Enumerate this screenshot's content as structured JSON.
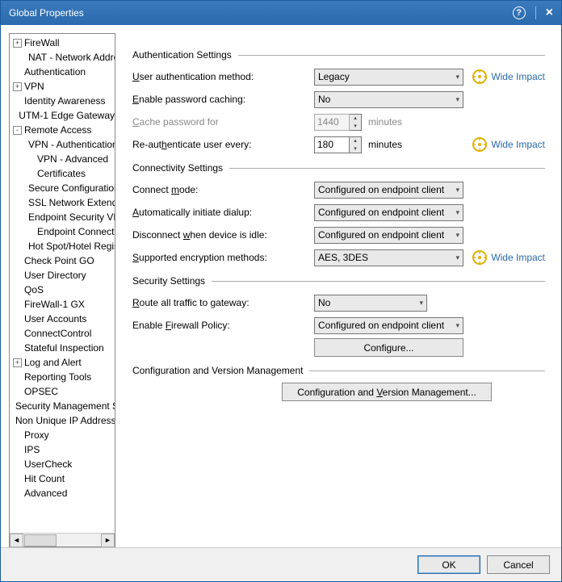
{
  "titlebar": {
    "title": "Global Properties"
  },
  "tree": [
    {
      "lvl": 1,
      "exp": "+",
      "label": "FireWall"
    },
    {
      "lvl": 2,
      "exp": "",
      "label": "NAT - Network Address"
    },
    {
      "lvl": 1,
      "exp": "",
      "label": "Authentication"
    },
    {
      "lvl": 1,
      "exp": "+",
      "label": "VPN"
    },
    {
      "lvl": 1,
      "exp": "",
      "label": "Identity Awareness"
    },
    {
      "lvl": 1,
      "exp": "",
      "label": "UTM-1 Edge Gateway"
    },
    {
      "lvl": 1,
      "exp": "-",
      "label": "Remote Access"
    },
    {
      "lvl": 2,
      "exp": "",
      "label": "VPN - Authentication"
    },
    {
      "lvl": 2,
      "exp": "",
      "label": "VPN - Advanced"
    },
    {
      "lvl": 2,
      "exp": "",
      "label": "Certificates"
    },
    {
      "lvl": 2,
      "exp": "",
      "label": "Secure Configuration"
    },
    {
      "lvl": 2,
      "exp": "",
      "label": "SSL Network Extender"
    },
    {
      "lvl": 2,
      "exp": "",
      "label": "Endpoint Security VPN"
    },
    {
      "lvl": 2,
      "exp": "",
      "label": "Endpoint Connect"
    },
    {
      "lvl": 2,
      "exp": "",
      "label": "Hot Spot/Hotel Registration"
    },
    {
      "lvl": 1,
      "exp": "",
      "label": "Check Point GO"
    },
    {
      "lvl": 1,
      "exp": "",
      "label": "User Directory"
    },
    {
      "lvl": 1,
      "exp": "",
      "label": "QoS"
    },
    {
      "lvl": 1,
      "exp": "",
      "label": "FireWall-1 GX"
    },
    {
      "lvl": 1,
      "exp": "",
      "label": "User Accounts"
    },
    {
      "lvl": 1,
      "exp": "",
      "label": "ConnectControl"
    },
    {
      "lvl": 1,
      "exp": "",
      "label": "Stateful Inspection"
    },
    {
      "lvl": 1,
      "exp": "+",
      "label": "Log and Alert"
    },
    {
      "lvl": 1,
      "exp": "",
      "label": "Reporting Tools"
    },
    {
      "lvl": 1,
      "exp": "",
      "label": "OPSEC"
    },
    {
      "lvl": 1,
      "exp": "",
      "label": "Security Management Server"
    },
    {
      "lvl": 1,
      "exp": "",
      "label": "Non Unique IP Addresses"
    },
    {
      "lvl": 1,
      "exp": "",
      "label": "Proxy"
    },
    {
      "lvl": 1,
      "exp": "",
      "label": "IPS"
    },
    {
      "lvl": 1,
      "exp": "",
      "label": "UserCheck"
    },
    {
      "lvl": 1,
      "exp": "",
      "label": "Hit Count"
    },
    {
      "lvl": 1,
      "exp": "",
      "label": "Advanced"
    }
  ],
  "sections": {
    "auth": "Authentication Settings",
    "conn": "Connectivity Settings",
    "sec": "Security Settings",
    "cvm": "Configuration and Version Management"
  },
  "labels": {
    "user_auth_method": "User authentication method:",
    "enable_pw_cache": "Enable password caching:",
    "cache_pw_for": "Cache password for",
    "reauth_every": "Re-authenticate user every:",
    "connect_mode": "Connect mode:",
    "auto_dialup": "Automatically initiate dialup:",
    "disconnect_idle": "Disconnect when device is idle:",
    "supported_enc": "Supported encryption methods:",
    "route_all": "Route all traffic to gateway:",
    "enable_fw_policy": "Enable Firewall Policy:"
  },
  "values": {
    "user_auth_method": "Legacy",
    "enable_pw_cache": "No",
    "cache_pw_for": "1440",
    "cache_pw_unit": "minutes",
    "reauth_every": "180",
    "reauth_unit": "minutes",
    "connect_mode": "Configured on endpoint client",
    "auto_dialup": "Configured on endpoint client",
    "disconnect_idle": "Configured on endpoint client",
    "supported_enc": "AES, 3DES",
    "route_all": "No",
    "enable_fw_policy": "Configured on endpoint client"
  },
  "buttons": {
    "configure": "Configure...",
    "cvm": "Configuration and Version Management...",
    "ok": "OK",
    "cancel": "Cancel"
  },
  "wide_impact": "Wide Impact"
}
